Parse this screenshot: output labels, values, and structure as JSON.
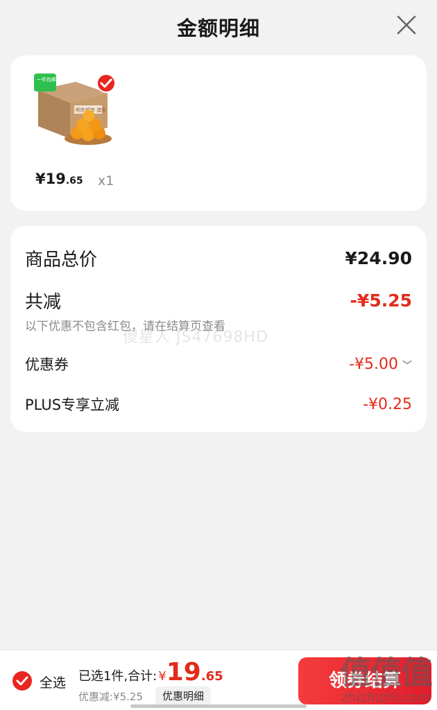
{
  "header": {
    "title": "金额明细",
    "close_icon": "close-icon"
  },
  "product": {
    "badge_text": "一件包邮",
    "brand_text": "明东超市 澳大",
    "price_symbol": "¥",
    "price_int": "19",
    "price_dec": ".65",
    "quantity": "x1",
    "selected": true
  },
  "details": {
    "total_label": "商品总价",
    "total_value": "¥24.90",
    "reduce_label": "共减",
    "reduce_value": "-¥5.25",
    "note": "以下优惠不包含红包，请在结算页查看",
    "watermark": "傻星人 JS47698HD",
    "coupon_label": "优惠券",
    "coupon_value": "-¥5.00",
    "coupon_chevron_icon": "chevron-down-icon",
    "plus_label": "PLUS专享立减",
    "plus_value": "-¥0.25"
  },
  "bottom": {
    "select_all": "全选",
    "summary": "已选1件,合计:",
    "total_symbol": "¥",
    "total_int": "19",
    "total_dec": ".65",
    "saved": "优惠减:¥5.25",
    "detail_button": "优惠明细",
    "checkout_button": "领券结算"
  },
  "site_watermark": {
    "big": "值值值",
    "small": "zhizhizhi.com"
  },
  "colors": {
    "accent_red": "#e22b1b",
    "card_bg": "#ffffff",
    "page_bg": "#f2f2f2"
  }
}
